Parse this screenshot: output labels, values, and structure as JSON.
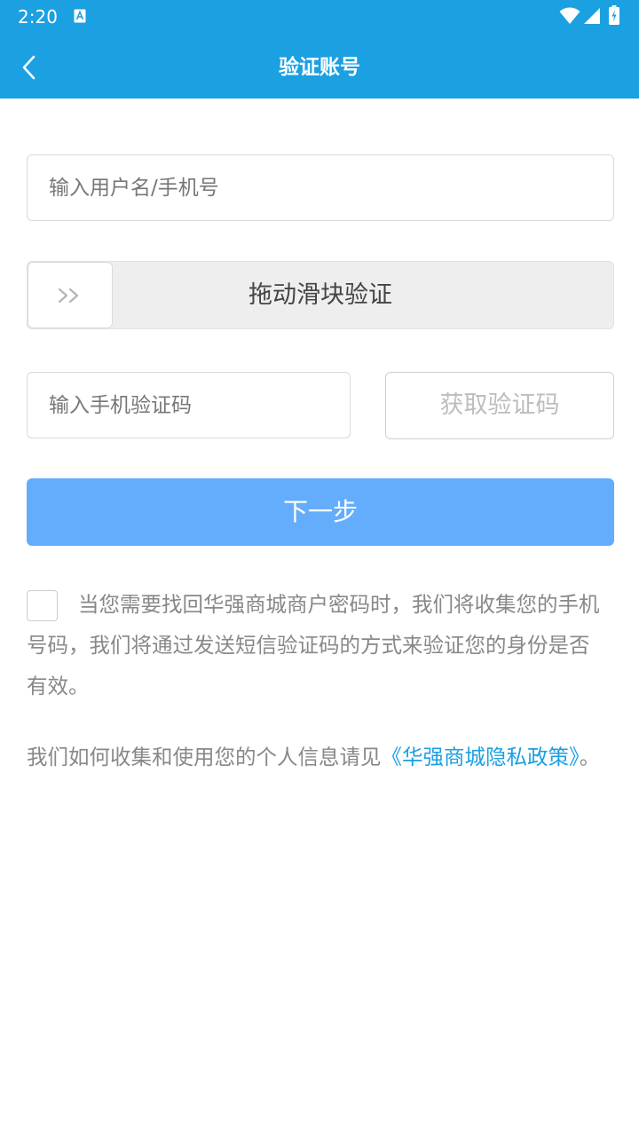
{
  "status_bar": {
    "time": "2:20",
    "icons": [
      "a-notification-icon",
      "wifi-icon",
      "signal-icon",
      "battery-icon"
    ]
  },
  "header": {
    "title": "验证账号",
    "back_icon": "chevron-left-icon",
    "background_color": "#1ba0e2"
  },
  "form": {
    "username_placeholder": "输入用户名/手机号",
    "slider_label": "拖动滑块验证",
    "slider_handle_icon": "double-chevron-right-icon",
    "sms_code_placeholder": "输入手机验证码",
    "get_code_label": "获取验证码",
    "next_label": "下一步",
    "next_color": "#64adfc"
  },
  "consent": {
    "checked": false,
    "text": "当您需要找回华强商城商户密码时，我们将收集您的手机号码，我们将通过发送短信验证码的方式来验证您的身份是否有效。"
  },
  "policy": {
    "prefix": "我们如何收集和使用您的个人信息请见",
    "link_text": "《华强商城隐私政策》",
    "suffix": "。",
    "link_color": "#1ba0e2"
  }
}
